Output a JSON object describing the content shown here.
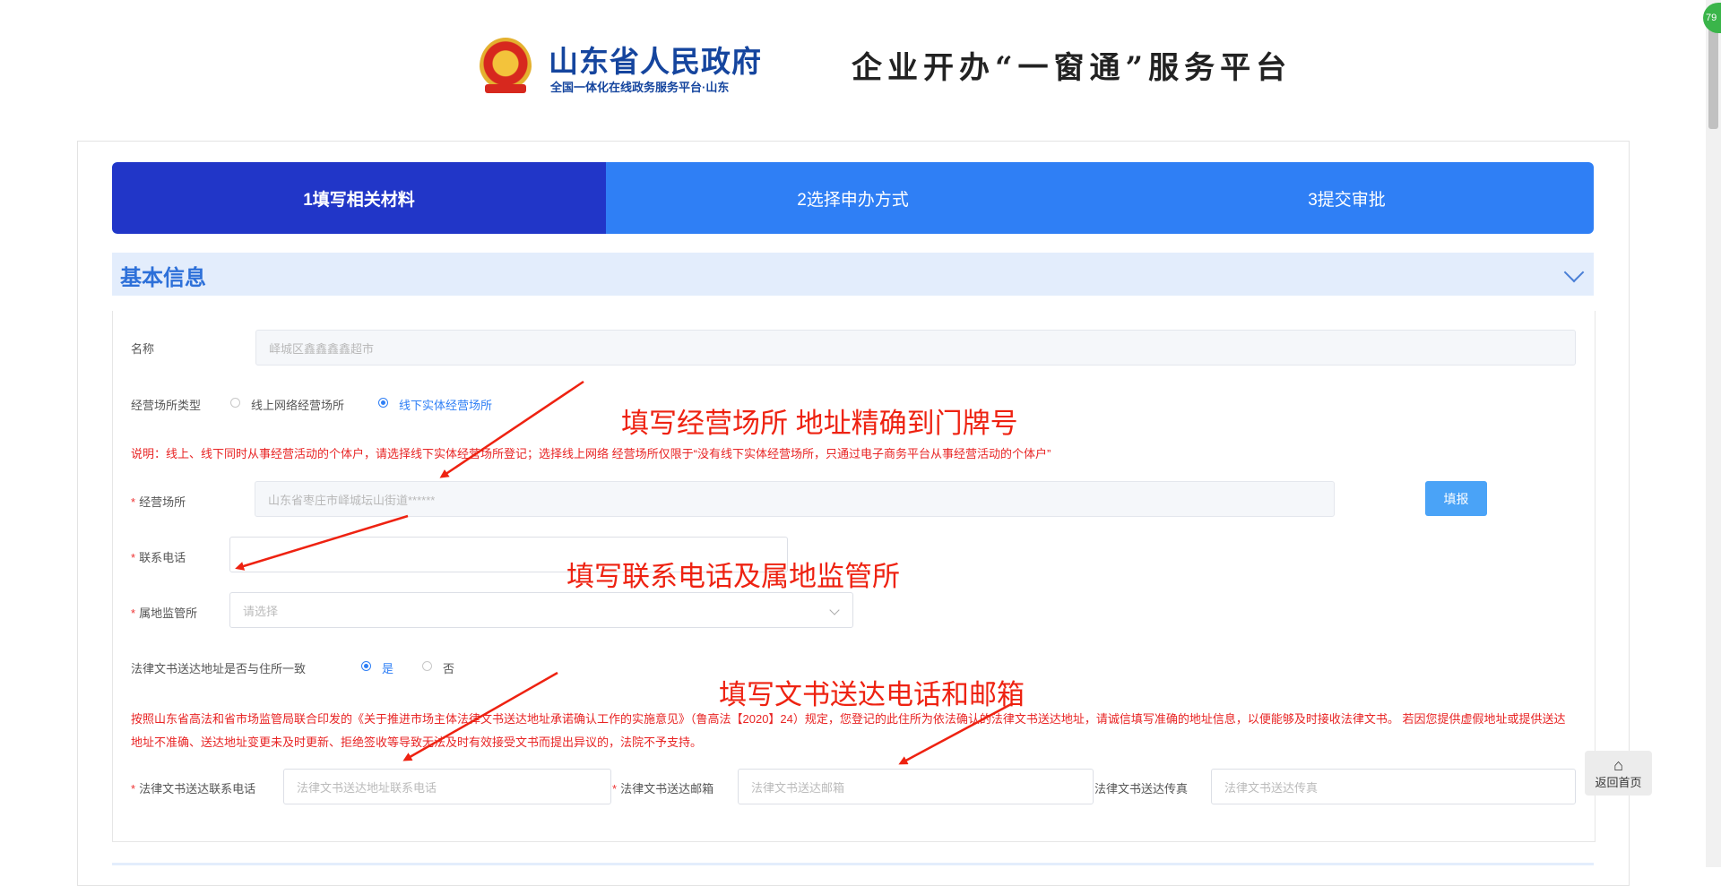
{
  "header": {
    "site_title": "山东省人民政府",
    "site_subtitle": "全国一体化在线政务服务平台·山东",
    "platform_title": "企业开办“一窗通”服务平台"
  },
  "steps": [
    {
      "label": "1填写相关材料",
      "active": true
    },
    {
      "label": "2选择申办方式",
      "active": false
    },
    {
      "label": "3提交审批",
      "active": false
    }
  ],
  "section": {
    "title": "基本信息"
  },
  "form": {
    "name_label": "名称",
    "name_value": "峄城区鑫鑫鑫鑫超市",
    "place_type_label": "经营场所类型",
    "place_type_options": [
      "线上网络经营场所",
      "线下实体经营场所"
    ],
    "place_type_selected": "线下实体经营场所",
    "place_note": "说明：线上、线下同时从事经营活动的个体户，请选择线下实体经营场所登记；选择线上网络 经营场所仅限于“没有线下实体经营场所，只通过电子商务平台从事经营活动的个体户”",
    "address_label": "经营场所",
    "address_value": "山东省枣庄市峄城坛山街道******",
    "fill_button": "填报",
    "phone_label": "联系电话",
    "phone_value": "",
    "station_label": "属地监管所",
    "station_placeholder": "请选择",
    "legal_same_label": "法律文书送达地址是否与住所一致",
    "legal_same_options": [
      "是",
      "否"
    ],
    "legal_same_selected": "是",
    "legal_note": "按照山东省高法和省市场监管局联合印发的《关于推进市场主体法律文书送达地址承诺确认工作的实施意见》（鲁高法【2020】24）规定，您登记的此住所为依法确认的法律文书送达地址，请诚信填写准确的地址信息，以便能够及时接收法律文书。 若因您提供虚假地址或提供送达地址不准确、送达地址变更未及时更新、拒绝签收等导致无法及时有效接受文书而提出异议的，法院不予支持。",
    "legal_phone_label": "法律文书送达联系电话",
    "legal_phone_placeholder": "法律文书送达地址联系电话",
    "legal_email_label": "法律文书送达邮箱",
    "legal_email_placeholder": "法律文书送达邮箱",
    "legal_fax_label": "法律文书送达传真",
    "legal_fax_placeholder": "法律文书送达传真"
  },
  "annotations": {
    "a1": "填写经营场所   地址精确到门牌号",
    "a2": "填写联系电话及属地监管所",
    "a3": "填写文书送达电话和邮箱"
  },
  "home_button": "返回首页",
  "badge": "79",
  "colors": {
    "brand_blue": "#2f7ff5",
    "active_step": "#2136c8",
    "annotation_red": "#ee2211"
  }
}
